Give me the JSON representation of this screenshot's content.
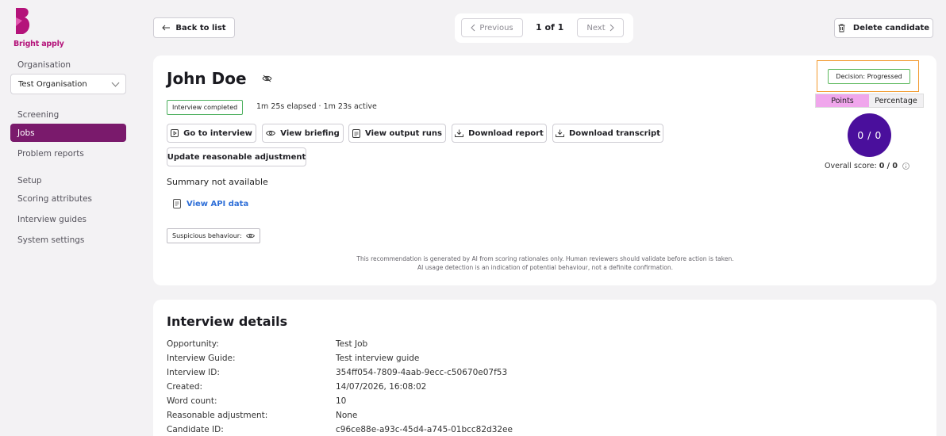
{
  "brand": {
    "name": "Bright apply",
    "color": "#b4137a"
  },
  "sidebar": {
    "organisation_label": "Organisation",
    "organisation_value": "Test Organisation",
    "screening_label": "Screening",
    "screening_items": [
      {
        "label": "Jobs",
        "active": true
      },
      {
        "label": "Problem reports",
        "active": false
      }
    ],
    "setup_label": "Setup",
    "setup_items": [
      {
        "label": "Scoring attributes"
      },
      {
        "label": "Interview guides"
      },
      {
        "label": "System settings"
      }
    ]
  },
  "header": {
    "back_label": "Back to list",
    "previous_label": "Previous",
    "page_count": "1 of 1",
    "next_label": "Next",
    "delete_label": "Delete candidate"
  },
  "candidate": {
    "name": "John Doe",
    "status_badge": "Interview completed",
    "elapsed": "1m 25s elapsed · 1m 23s active",
    "actions": {
      "go_to_interview": "Go to interview",
      "view_briefing": "View briefing",
      "view_output_runs": "View output runs",
      "download_report": "Download report",
      "download_transcript": "Download transcript",
      "update_adjustment": "Update reasonable adjustment"
    },
    "summary": "Summary not available",
    "api_link": "View API data",
    "suspicious_label": "Suspicious behaviour:",
    "disclaimer_line1": "This recommendation is generated by AI from scoring rationales only. Human reviewers should validate before action is taken.",
    "disclaimer_line2": "AI usage detection is an indication of potential behaviour, not a definite confirmation.",
    "decision": "Decision: Progressed",
    "toggle_points": "Points",
    "toggle_percentage": "Percentage",
    "score": "0 / 0",
    "overall_label": "Overall score:",
    "overall_value": "0 / 0"
  },
  "details": {
    "title": "Interview details",
    "rows": [
      {
        "label": "Opportunity:",
        "value": "Test Job"
      },
      {
        "label": "Interview Guide:",
        "value": "Test interview guide"
      },
      {
        "label": "Interview ID:",
        "value": "354ff054-7809-4aab-9ecc-c50670e07f53"
      },
      {
        "label": "Created:",
        "value": "14/07/2026, 16:08:02"
      },
      {
        "label": "Word count:",
        "value": "10"
      },
      {
        "label": "Reasonable adjustment:",
        "value": "None"
      },
      {
        "label": "Candidate ID:",
        "value": "c96ce88e-a93c-45d4-a745-01bcc82d32ee"
      }
    ]
  },
  "colors": {
    "active_nav": "#7a1a6c",
    "score_circle": "#4a0f9c",
    "decision_highlight": "#f29a2e",
    "points_toggle": "#f0a6ec",
    "link": "#2f6fd8"
  }
}
